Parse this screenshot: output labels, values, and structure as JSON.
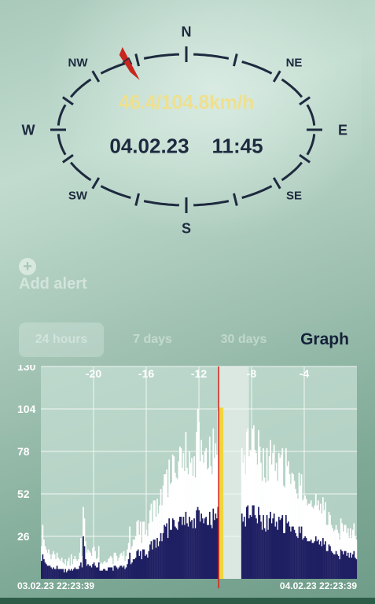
{
  "compass": {
    "directions": {
      "n": "N",
      "ne": "NE",
      "e": "E",
      "se": "SE",
      "s": "S",
      "sw": "SW",
      "w": "W",
      "nw": "NW"
    },
    "wind_speed": "46.4/104.8km/h",
    "date": "04.02.23",
    "time": "11:45",
    "needle_direction": "NNW",
    "needle_color": "#c9261e",
    "ring_color": "#1e2a3f",
    "wind_color": "#efe08e"
  },
  "alert": {
    "icon": "plus-circle-icon",
    "label": "Add alert"
  },
  "tabs": [
    {
      "label": "24 hours",
      "selected_bg": true
    },
    {
      "label": "7 days"
    },
    {
      "label": "30 days"
    },
    {
      "label": "Graph",
      "active": true
    }
  ],
  "chart_data": {
    "type": "bar",
    "x_tick_labels": [
      "-20",
      "-16",
      "-12",
      "-8",
      "-4"
    ],
    "x_ticks": [
      -20,
      -16,
      -12,
      -8,
      -4
    ],
    "y_ticks": [
      26,
      52,
      78,
      104,
      130
    ],
    "y_tick_labels": [
      "26",
      "52",
      "78",
      "104",
      "130"
    ],
    "ylim": [
      0,
      130
    ],
    "xlim": [
      -24,
      0
    ],
    "grid": true,
    "start_label": "03.02.23  22:23:39",
    "end_label": "04.02.23  22:23:39",
    "cursor_x": -10.5,
    "cursor_value": 104.8,
    "gap": [
      -10.5,
      -8.2
    ],
    "colors": {
      "gust": "#ffffff",
      "average": "#1f1f63",
      "cursor": "#d42a20",
      "cursor_bar": "#f0d63a",
      "plot_bg": "#c6dfd4"
    },
    "series": [
      {
        "values": [
          20,
          33,
          24,
          20,
          18,
          16,
          18,
          15,
          12,
          15,
          17,
          15,
          12,
          16,
          13,
          12,
          11,
          13,
          10,
          9,
          12,
          8,
          11,
          13,
          8,
          15,
          9,
          12,
          14,
          12,
          11,
          12,
          16,
          25,
          14,
          44,
          37,
          23,
          16,
          18,
          17,
          16,
          14,
          19,
          20,
          17,
          12,
          13,
          20,
          9,
          10,
          9,
          10,
          11,
          10,
          10,
          12,
          13,
          14,
          13,
          9,
          16,
          16,
          14,
          11,
          13,
          15,
          16,
          14,
          17,
          11,
          14,
          18,
          22,
          32,
          18,
          20,
          24,
          24,
          26,
          35,
          36,
          27,
          35,
          22,
          35,
          35,
          27,
          30,
          26,
          34,
          42,
          46,
          35,
          48,
          48,
          38,
          49,
          40,
          45,
          55,
          45,
          57,
          64,
          64,
          67,
          50,
          73,
          58,
          59,
          76,
          75,
          65,
          62,
          61,
          72,
          81,
          80,
          68,
          77,
          66,
          90,
          68,
          64,
          78,
          71,
          74,
          63,
          75,
          62,
          90,
          104,
          96,
          72,
          85,
          76,
          71,
          78,
          80,
          67,
          68,
          87,
          69,
          64,
          92,
          74,
          83,
          76,
          103,
          104.8,
          0,
          0,
          0,
          0,
          0,
          0,
          0,
          0,
          0,
          0,
          0,
          0,
          0,
          0,
          0,
          0,
          0,
          0,
          80,
          71,
          76,
          64,
          90,
          92,
          75,
          79,
          78,
          92,
          94,
          79,
          77,
          70,
          91,
          81,
          71,
          60,
          80,
          62,
          59,
          80,
          60,
          75,
          85,
          70,
          77,
          82,
          66,
          71,
          60,
          77,
          74,
          76,
          80,
          57,
          56,
          80,
          69,
          72,
          64,
          58,
          65,
          64,
          60,
          55,
          52,
          49,
          65,
          57,
          64,
          48,
          49,
          51,
          49,
          45,
          46,
          46,
          48,
          44,
          43,
          45,
          52,
          45,
          48,
          42,
          46,
          40,
          50,
          42,
          47,
          33,
          33,
          41,
          39,
          33,
          31,
          29,
          30,
          33,
          30,
          28,
          24,
          37,
          34,
          29,
          33,
          33,
          28,
          31,
          25,
          31,
          25,
          30,
          34,
          26,
          24
        ]
      },
      {
        "values": [
          11,
          15,
          12,
          10,
          9,
          8,
          8,
          8,
          7,
          6,
          7,
          6,
          6,
          8,
          6,
          6,
          6,
          6,
          6,
          4,
          6,
          4,
          5,
          6,
          5,
          6,
          5,
          6,
          7,
          6,
          6,
          6,
          8,
          10,
          7,
          26,
          20,
          12,
          8,
          9,
          8,
          8,
          7,
          9,
          10,
          8,
          7,
          7,
          10,
          5,
          5,
          5,
          6,
          6,
          5,
          5,
          7,
          7,
          7,
          7,
          5,
          8,
          8,
          7,
          6,
          7,
          8,
          8,
          7,
          8,
          6,
          7,
          9,
          12,
          16,
          9,
          10,
          12,
          12,
          13,
          17,
          18,
          14,
          17,
          12,
          18,
          18,
          14,
          15,
          13,
          17,
          21,
          23,
          18,
          24,
          24,
          19,
          25,
          20,
          23,
          28,
          23,
          28,
          33,
          32,
          34,
          25,
          37,
          30,
          30,
          37,
          36,
          32,
          31,
          30,
          35,
          38,
          38,
          33,
          38,
          33,
          41,
          34,
          32,
          38,
          35,
          36,
          31,
          37,
          31,
          42,
          44,
          42,
          35,
          40,
          37,
          34,
          37,
          38,
          33,
          33,
          41,
          33,
          31,
          43,
          36,
          40,
          37,
          44,
          46.4,
          0,
          0,
          0,
          0,
          0,
          0,
          0,
          0,
          0,
          0,
          0,
          0,
          0,
          0,
          0,
          0,
          0,
          0,
          40,
          35,
          38,
          32,
          44,
          45,
          37,
          39,
          38,
          45,
          45,
          39,
          37,
          34,
          44,
          39,
          35,
          30,
          39,
          31,
          29,
          39,
          30,
          37,
          41,
          34,
          37,
          40,
          32,
          35,
          30,
          38,
          36,
          37,
          39,
          28,
          28,
          39,
          34,
          35,
          32,
          29,
          32,
          32,
          30,
          28,
          26,
          25,
          32,
          28,
          32,
          24,
          25,
          26,
          25,
          23,
          23,
          23,
          24,
          22,
          22,
          23,
          26,
          23,
          24,
          21,
          23,
          20,
          25,
          21,
          23,
          17,
          17,
          21,
          20,
          17,
          16,
          15,
          15,
          17,
          15,
          14,
          12,
          18,
          17,
          15,
          17,
          17,
          14,
          16,
          13,
          16,
          13,
          15,
          17,
          13,
          12
        ]
      }
    ]
  }
}
